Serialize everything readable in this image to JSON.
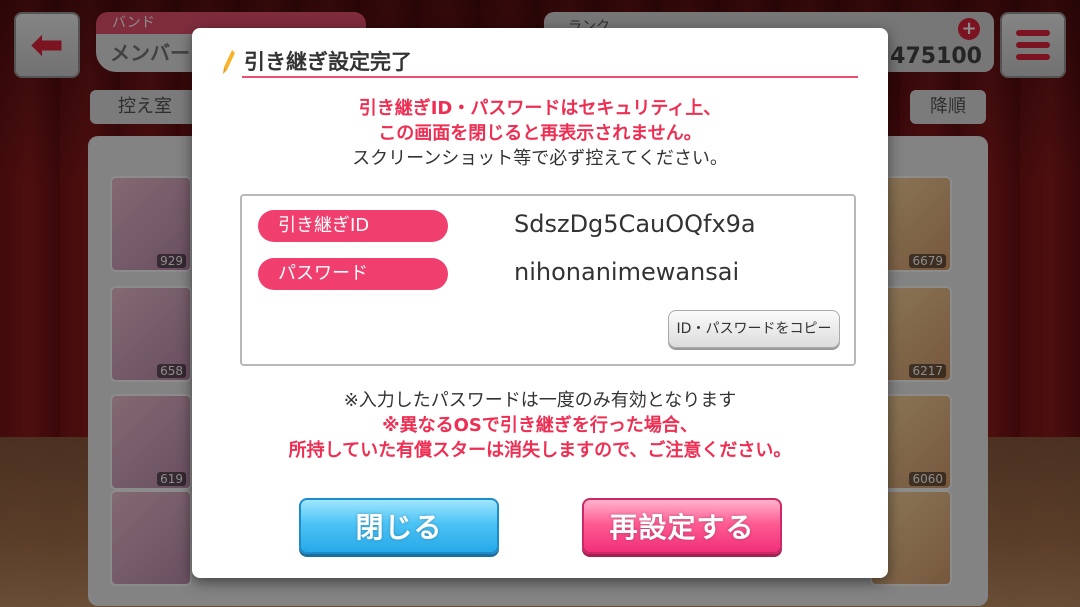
{
  "hud": {
    "band_label": "バンド",
    "band_sub": "メンバー",
    "rank_label": "ランク",
    "stat_value": "475100",
    "tab_left": "控え室",
    "tab_right": "降順"
  },
  "cards_left": [
    "929",
    "658",
    "619",
    ""
  ],
  "cards_right": [
    "6679",
    "6217",
    "6060",
    ""
  ],
  "dialog": {
    "title": "引き継ぎ設定完了",
    "warning_line1": "引き継ぎID・パスワードはセキュリティ上、",
    "warning_line2": "この画面を閉じると再表示されません。",
    "warning_line3": "スクリーンショット等で必ず控えてください。",
    "id_label": "引き継ぎID",
    "id_value": "SdszDg5CauOQfx9a",
    "password_label": "パスワード",
    "password_value": "nihonanimewansai",
    "copy_button": "ID・パスワードをコピー",
    "note_line1": "※入力したパスワードは一度のみ有効となります",
    "note_line2": "※異なるOSで引き継ぎを行った場合、",
    "note_line3": "所持していた有償スターは消失しますので、ご注意ください。",
    "close_button": "閉じる",
    "reset_button": "再設定する"
  },
  "colors": {
    "accent_pink": "#f03f6e",
    "warning_red": "#ee2f54",
    "close_blue": "#27a9e8",
    "reset_pink": "#f0307a"
  }
}
